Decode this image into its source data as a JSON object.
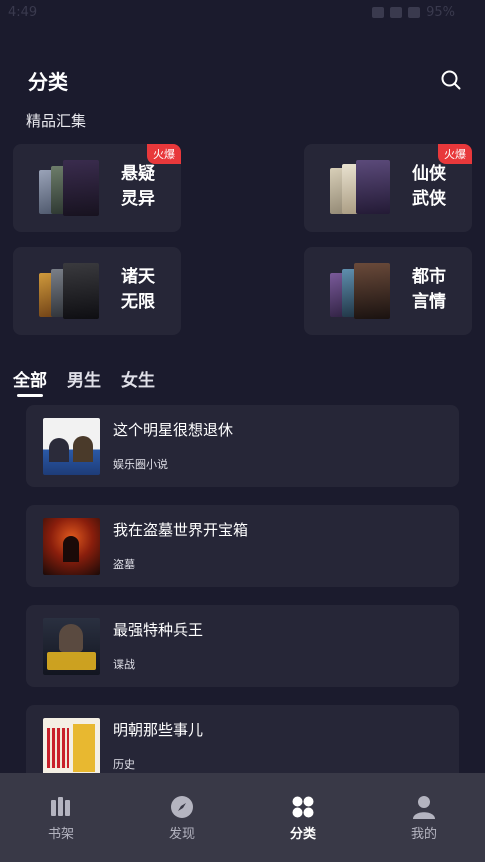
{
  "status_bar": {
    "time": "4:49",
    "battery": "95%"
  },
  "header": {
    "title": "分类"
  },
  "featured": {
    "title": "精品汇集",
    "cards": [
      {
        "name": "悬疑灵异",
        "badge": "火爆"
      },
      {
        "name": "仙侠武侠",
        "badge": "火爆"
      },
      {
        "name": "诸天无限",
        "badge": ""
      },
      {
        "name": "都市言情",
        "badge": ""
      }
    ]
  },
  "tabs": [
    {
      "label": "全部",
      "active": true
    },
    {
      "label": "男生",
      "active": false
    },
    {
      "label": "女生",
      "active": false
    }
  ],
  "books": [
    {
      "title": "这个明星很想退休",
      "tag": "娱乐圈小说"
    },
    {
      "title": "我在盗墓世界开宝箱",
      "tag": "盗墓"
    },
    {
      "title": "最强特种兵王",
      "tag": "谍战"
    },
    {
      "title": "明朝那些事儿",
      "tag": "历史"
    }
  ],
  "bottom_nav": [
    {
      "label": "书架",
      "icon": "bookshelf-icon",
      "active": false
    },
    {
      "label": "发现",
      "icon": "compass-icon",
      "active": false
    },
    {
      "label": "分类",
      "icon": "category-grid-icon",
      "active": true
    },
    {
      "label": "我的",
      "icon": "user-icon",
      "active": false
    }
  ],
  "colors": {
    "background": "#1b1b2d",
    "card": "#262637",
    "badge": "#e8383b",
    "nav": "#393947"
  }
}
